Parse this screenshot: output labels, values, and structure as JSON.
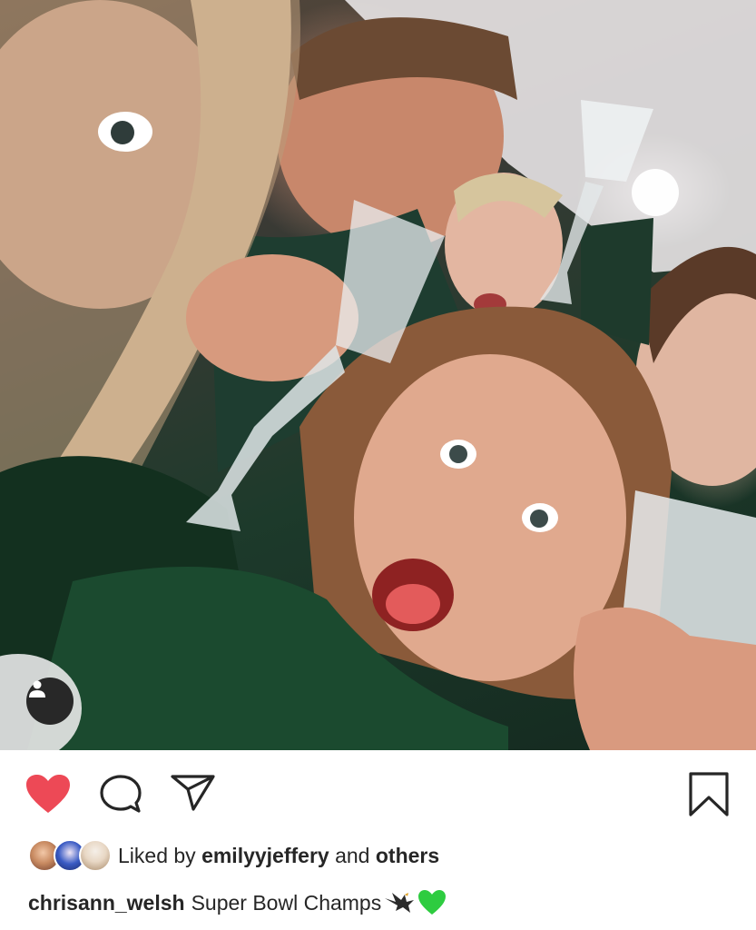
{
  "post": {
    "photo_alt": "selfie-photo",
    "tag_people_icon": "person-icon",
    "actions": {
      "like_icon": "heart-filled-icon",
      "like_color": "#ed4956",
      "comment_icon": "comment-bubble-icon",
      "share_icon": "paper-plane-icon",
      "save_icon": "bookmark-icon"
    },
    "likes": {
      "prefix": "Liked by",
      "user": "emilyyjeffery",
      "conjunction": "and",
      "others": "others"
    },
    "caption": {
      "username": "chrisann_welsh",
      "text": "Super Bowl Champs",
      "emoji_1": "eagle-emoji-icon",
      "emoji_2": "green-heart-emoji-icon"
    }
  },
  "colors": {
    "text": "#262626",
    "heart": "#ed4956",
    "green_heart": "#2ecc40",
    "tag_button_bg": "#191919"
  }
}
